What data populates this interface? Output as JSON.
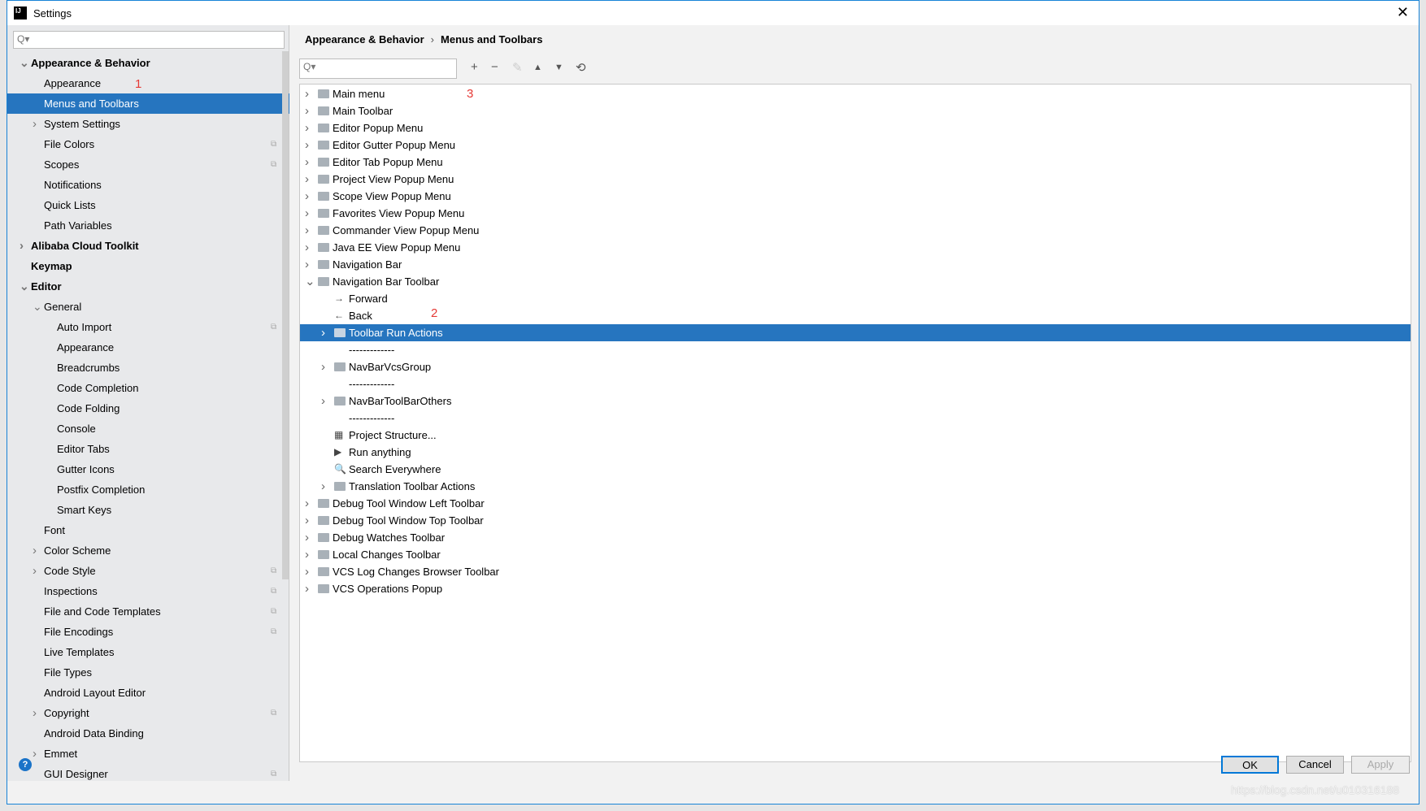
{
  "window": {
    "title": "Settings",
    "close_icon": "close-icon"
  },
  "sidebar": {
    "search_placeholder": "Q▾",
    "items": [
      {
        "label": "Appearance & Behavior",
        "level": 0,
        "arrow": "down",
        "bold": true
      },
      {
        "label": "Appearance",
        "level": 1
      },
      {
        "label": "Menus and Toolbars",
        "level": 1,
        "selected": true
      },
      {
        "label": "System Settings",
        "level": 1,
        "arrow": "right"
      },
      {
        "label": "File Colors",
        "level": 1,
        "copy": true
      },
      {
        "label": "Scopes",
        "level": 1,
        "copy": true
      },
      {
        "label": "Notifications",
        "level": 1
      },
      {
        "label": "Quick Lists",
        "level": 1
      },
      {
        "label": "Path Variables",
        "level": 1
      },
      {
        "label": "Alibaba Cloud Toolkit",
        "level": 0,
        "arrow": "right",
        "bold": true
      },
      {
        "label": "Keymap",
        "level": 0,
        "bold": true
      },
      {
        "label": "Editor",
        "level": 0,
        "arrow": "down",
        "bold": true
      },
      {
        "label": "General",
        "level": 1,
        "arrow": "down"
      },
      {
        "label": "Auto Import",
        "level": 2,
        "copy": true
      },
      {
        "label": "Appearance",
        "level": 2
      },
      {
        "label": "Breadcrumbs",
        "level": 2
      },
      {
        "label": "Code Completion",
        "level": 2
      },
      {
        "label": "Code Folding",
        "level": 2
      },
      {
        "label": "Console",
        "level": 2
      },
      {
        "label": "Editor Tabs",
        "level": 2
      },
      {
        "label": "Gutter Icons",
        "level": 2
      },
      {
        "label": "Postfix Completion",
        "level": 2
      },
      {
        "label": "Smart Keys",
        "level": 2
      },
      {
        "label": "Font",
        "level": 1
      },
      {
        "label": "Color Scheme",
        "level": 1,
        "arrow": "right"
      },
      {
        "label": "Code Style",
        "level": 1,
        "arrow": "right",
        "copy": true
      },
      {
        "label": "Inspections",
        "level": 1,
        "copy": true
      },
      {
        "label": "File and Code Templates",
        "level": 1,
        "copy": true
      },
      {
        "label": "File Encodings",
        "level": 1,
        "copy": true
      },
      {
        "label": "Live Templates",
        "level": 1
      },
      {
        "label": "File Types",
        "level": 1
      },
      {
        "label": "Android Layout Editor",
        "level": 1
      },
      {
        "label": "Copyright",
        "level": 1,
        "arrow": "right",
        "copy": true
      },
      {
        "label": "Android Data Binding",
        "level": 1
      },
      {
        "label": "Emmet",
        "level": 1,
        "arrow": "right"
      },
      {
        "label": "GUI Designer",
        "level": 1,
        "copy": true
      }
    ]
  },
  "breadcrumb": {
    "parent": "Appearance & Behavior",
    "separator": "›",
    "current": "Menus and Toolbars"
  },
  "toolbar": {
    "search_placeholder": "Q▾",
    "add": "+",
    "remove": "−",
    "edit": "✎",
    "up": "▲",
    "down": "▼",
    "restore": "⟲"
  },
  "tree": [
    {
      "label": "Main menu",
      "level": 0,
      "arrow": "right",
      "icon": "folder"
    },
    {
      "label": "Main Toolbar",
      "level": 0,
      "arrow": "right",
      "icon": "folder"
    },
    {
      "label": "Editor Popup Menu",
      "level": 0,
      "arrow": "right",
      "icon": "folder"
    },
    {
      "label": "Editor Gutter Popup Menu",
      "level": 0,
      "arrow": "right",
      "icon": "folder"
    },
    {
      "label": "Editor Tab Popup Menu",
      "level": 0,
      "arrow": "right",
      "icon": "folder"
    },
    {
      "label": "Project View Popup Menu",
      "level": 0,
      "arrow": "right",
      "icon": "folder"
    },
    {
      "label": "Scope View Popup Menu",
      "level": 0,
      "arrow": "right",
      "icon": "folder"
    },
    {
      "label": "Favorites View Popup Menu",
      "level": 0,
      "arrow": "right",
      "icon": "folder"
    },
    {
      "label": "Commander View Popup Menu",
      "level": 0,
      "arrow": "right",
      "icon": "folder"
    },
    {
      "label": "Java EE View Popup Menu",
      "level": 0,
      "arrow": "right",
      "icon": "folder"
    },
    {
      "label": "Navigation Bar",
      "level": 0,
      "arrow": "right",
      "icon": "folder"
    },
    {
      "label": "Navigation Bar Toolbar",
      "level": 0,
      "arrow": "down",
      "icon": "folder"
    },
    {
      "label": "Forward",
      "level": 1,
      "icon": "→"
    },
    {
      "label": "Back",
      "level": 1,
      "icon": "←"
    },
    {
      "label": "Toolbar Run Actions",
      "level": 1,
      "arrow": "right",
      "icon": "folder",
      "selected": true
    },
    {
      "label": "-------------",
      "level": 1
    },
    {
      "label": "NavBarVcsGroup",
      "level": 1,
      "arrow": "right",
      "icon": "folder"
    },
    {
      "label": "-------------",
      "level": 1
    },
    {
      "label": "NavBarToolBarOthers",
      "level": 1,
      "arrow": "right",
      "icon": "folder"
    },
    {
      "label": "-------------",
      "level": 1
    },
    {
      "label": "Project Structure...",
      "level": 1,
      "icon": "▦"
    },
    {
      "label": "Run anything",
      "level": 1,
      "icon": "▶"
    },
    {
      "label": "Search Everywhere",
      "level": 1,
      "icon": "🔍"
    },
    {
      "label": "Translation Toolbar Actions",
      "level": 1,
      "arrow": "right",
      "icon": "folder"
    },
    {
      "label": "Debug Tool Window Left Toolbar",
      "level": 0,
      "arrow": "right",
      "icon": "folder"
    },
    {
      "label": "Debug Tool Window Top Toolbar",
      "level": 0,
      "arrow": "right",
      "icon": "folder"
    },
    {
      "label": "Debug Watches Toolbar",
      "level": 0,
      "arrow": "right",
      "icon": "folder"
    },
    {
      "label": "Local Changes Toolbar",
      "level": 0,
      "arrow": "right",
      "icon": "folder"
    },
    {
      "label": "VCS Log Changes Browser Toolbar",
      "level": 0,
      "arrow": "right",
      "icon": "folder"
    },
    {
      "label": "VCS Operations Popup",
      "level": 0,
      "arrow": "right",
      "icon": "folder"
    }
  ],
  "annotations": {
    "n1": "1",
    "n2": "2",
    "n3": "3"
  },
  "buttons": {
    "ok": "OK",
    "cancel": "Cancel",
    "apply": "Apply",
    "help": "?"
  },
  "watermark": "https://blog.csdn.net/u010316188",
  "colors": {
    "selection": "#2675bf",
    "annotation": "#e53935"
  }
}
